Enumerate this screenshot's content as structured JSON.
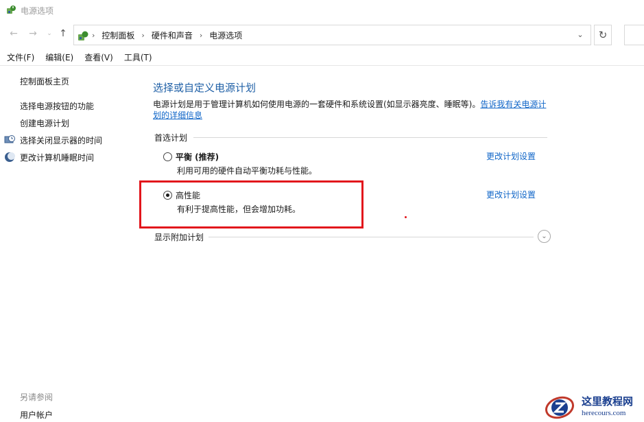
{
  "window": {
    "title": "电源选项"
  },
  "navigation": {
    "back_icon": "back-arrow-icon",
    "forward_icon": "forward-arrow-icon",
    "recent_icon": "chevron-down-icon",
    "up_icon": "up-arrow-icon",
    "breadcrumbs": [
      "控制面板",
      "硬件和声音",
      "电源选项"
    ],
    "refresh_glyph": "↻"
  },
  "menubar": {
    "items": [
      "文件(F)",
      "编辑(E)",
      "查看(V)",
      "工具(T)"
    ]
  },
  "sidebar": {
    "home": "控制面板主页",
    "links": [
      "选择电源按钮的功能",
      "创建电源计划",
      "选择关闭显示器的时间",
      "更改计算机睡眠时间"
    ],
    "see_also": "另请参阅",
    "user_accounts": "用户帐户"
  },
  "main": {
    "heading": "选择或自定义电源计划",
    "description": "电源计划是用于管理计算机如何使用电源的一套硬件和系统设置(如显示器亮度、睡眠等)。",
    "description_link": "告诉我有关电源计划的详细信息",
    "preferred_label": "首选计划",
    "plans": [
      {
        "name": "平衡 (推荐)",
        "description": "利用可用的硬件自动平衡功耗与性能。",
        "selected": false,
        "change_link": "更改计划设置"
      },
      {
        "name": "高性能",
        "description": "有利于提高性能，但会增加功耗。",
        "selected": true,
        "change_link": "更改计划设置"
      }
    ],
    "more_plans_label": "显示附加计划"
  },
  "watermark": {
    "title": "这里教程网",
    "url": "herecours.com"
  },
  "colors": {
    "accent_blue": "#1e5fa6",
    "link_blue": "#1066c8",
    "highlight_red": "#e2151c"
  }
}
